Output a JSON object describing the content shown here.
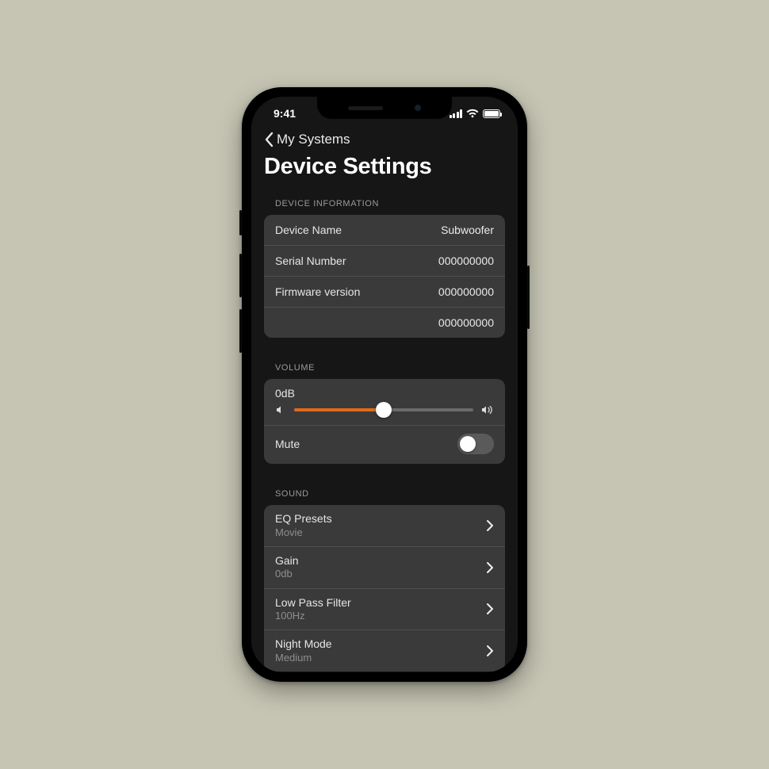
{
  "status": {
    "time": "9:41"
  },
  "nav": {
    "back_label": "My Systems"
  },
  "page": {
    "title": "Device Settings"
  },
  "device_info": {
    "header": "DEVICE INFORMATION",
    "rows": [
      {
        "label": "Device Name",
        "value": "Subwoofer"
      },
      {
        "label": "Serial Number",
        "value": "000000000"
      },
      {
        "label": "Firmware version",
        "value": "000000000"
      },
      {
        "label": "",
        "value": "000000000"
      }
    ]
  },
  "volume": {
    "header": "VOLUME",
    "value_label": "0dB",
    "slider_percent": 50,
    "mute_label": "Mute",
    "mute_on": false
  },
  "sound": {
    "header": "SOUND",
    "items": [
      {
        "title": "EQ Presets",
        "sub": "Movie"
      },
      {
        "title": "Gain",
        "sub": "0db"
      },
      {
        "title": "Low Pass Filter",
        "sub": "100Hz"
      },
      {
        "title": "Night Mode",
        "sub": "Medium"
      }
    ]
  },
  "colors": {
    "accent": "#e06a1b"
  }
}
